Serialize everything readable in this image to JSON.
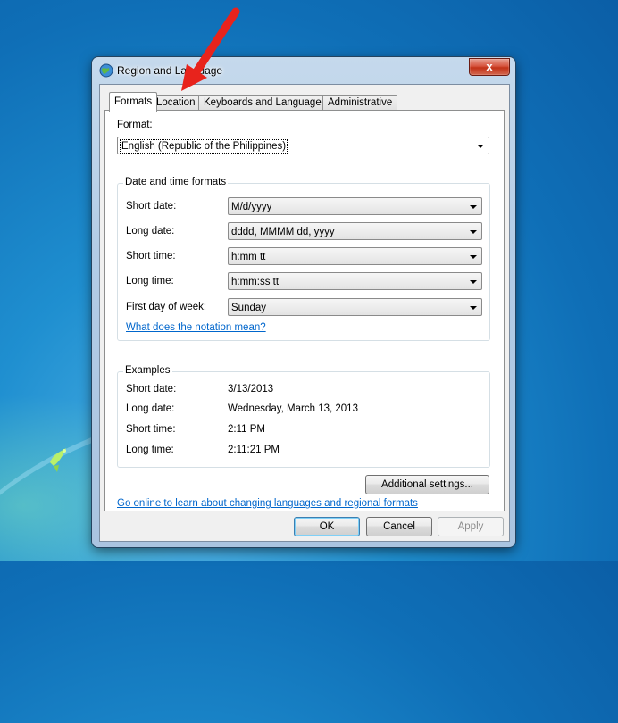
{
  "window": {
    "title": "Region and Language",
    "close_label": "x"
  },
  "tabs": [
    {
      "label": "Formats",
      "active": true
    },
    {
      "label": "Location",
      "active": false
    },
    {
      "label": "Keyboards and Languages",
      "active": false
    },
    {
      "label": "Administrative",
      "active": false
    }
  ],
  "format": {
    "label": "Format:",
    "value": "English (Republic of the Philippines)"
  },
  "date_time_formats": {
    "title": "Date and time formats",
    "rows": [
      {
        "label": "Short date:",
        "value": "M/d/yyyy"
      },
      {
        "label": "Long date:",
        "value": "dddd, MMMM dd, yyyy"
      },
      {
        "label": "Short time:",
        "value": "h:mm tt"
      },
      {
        "label": "Long time:",
        "value": "h:mm:ss tt"
      },
      {
        "label": "First day of week:",
        "value": "Sunday"
      }
    ],
    "notation_link": "What does the notation mean?"
  },
  "examples": {
    "title": "Examples",
    "rows": [
      {
        "label": "Short date:",
        "value": "3/13/2013"
      },
      {
        "label": "Long date:",
        "value": "Wednesday, March 13, 2013"
      },
      {
        "label": "Short time:",
        "value": "2:11 PM"
      },
      {
        "label": "Long time:",
        "value": "2:11:21 PM"
      }
    ]
  },
  "additional_settings_label": "Additional settings...",
  "online_link": "Go online to learn about changing languages and regional formats",
  "buttons": {
    "ok": "OK",
    "cancel": "Cancel",
    "apply": "Apply"
  },
  "colors": {
    "annotation_arrow": "#e8231c",
    "link": "#0066cc",
    "desktop": "#1f8fd0"
  }
}
